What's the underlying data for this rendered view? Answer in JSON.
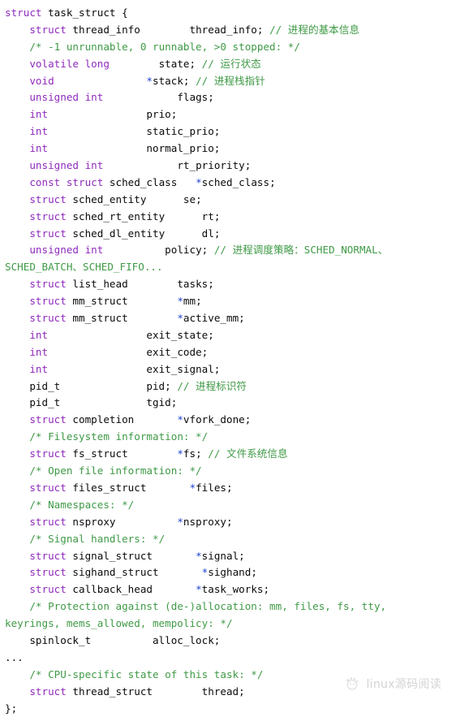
{
  "document": {
    "kind": "source-code-listing",
    "language": "c",
    "colors": {
      "background": "#ffffff",
      "keyword": "#8f2bbd",
      "comment": "#3f9a46",
      "identifier": "#0a0a0a",
      "pointer": "#1a3fd0",
      "watermark": "#b9b9b9"
    }
  },
  "watermark": {
    "logo_icon": "cat-paw-circle-icon",
    "text": "linux源码阅读"
  },
  "code": {
    "lines": [
      [
        {
          "t": "struct",
          "c": "kw"
        },
        {
          "t": " task_struct {",
          "c": "id"
        }
      ],
      [
        {
          "t": "    ",
          "c": "pun"
        },
        {
          "t": "struct",
          "c": "kw"
        },
        {
          "t": " thread_info        thread_info; ",
          "c": "id"
        },
        {
          "t": "// 进程的基本信息",
          "c": "cm"
        }
      ],
      [
        {
          "t": "    ",
          "c": "pun"
        },
        {
          "t": "/* -1 unrunnable, 0 runnable, >0 stopped: */",
          "c": "cm"
        }
      ],
      [
        {
          "t": "    ",
          "c": "pun"
        },
        {
          "t": "volatile long",
          "c": "kw"
        },
        {
          "t": "        state; ",
          "c": "id"
        },
        {
          "t": "// 运行状态",
          "c": "cm"
        }
      ],
      [
        {
          "t": "    ",
          "c": "pun"
        },
        {
          "t": "void",
          "c": "kw"
        },
        {
          "t": "               ",
          "c": "id"
        },
        {
          "t": "*",
          "c": "ptr"
        },
        {
          "t": "stack; ",
          "c": "id"
        },
        {
          "t": "// 进程栈指针",
          "c": "cm"
        }
      ],
      [
        {
          "t": "    ",
          "c": "pun"
        },
        {
          "t": "unsigned int",
          "c": "kw"
        },
        {
          "t": "            flags;",
          "c": "id"
        }
      ],
      [
        {
          "t": "    ",
          "c": "pun"
        },
        {
          "t": "int",
          "c": "kw"
        },
        {
          "t": "                prio;",
          "c": "id"
        }
      ],
      [
        {
          "t": "    ",
          "c": "pun"
        },
        {
          "t": "int",
          "c": "kw"
        },
        {
          "t": "                static_prio;",
          "c": "id"
        }
      ],
      [
        {
          "t": "    ",
          "c": "pun"
        },
        {
          "t": "int",
          "c": "kw"
        },
        {
          "t": "                normal_prio;",
          "c": "id"
        }
      ],
      [
        {
          "t": "    ",
          "c": "pun"
        },
        {
          "t": "unsigned int",
          "c": "kw"
        },
        {
          "t": "            rt_priority;",
          "c": "id"
        }
      ],
      [
        {
          "t": "    ",
          "c": "pun"
        },
        {
          "t": "const struct",
          "c": "kw"
        },
        {
          "t": " sched_class   ",
          "c": "id"
        },
        {
          "t": "*",
          "c": "ptr"
        },
        {
          "t": "sched_class;",
          "c": "id"
        }
      ],
      [
        {
          "t": "    ",
          "c": "pun"
        },
        {
          "t": "struct",
          "c": "kw"
        },
        {
          "t": " sched_entity      se;",
          "c": "id"
        }
      ],
      [
        {
          "t": "    ",
          "c": "pun"
        },
        {
          "t": "struct",
          "c": "kw"
        },
        {
          "t": " sched_rt_entity      rt;",
          "c": "id"
        }
      ],
      [
        {
          "t": "    ",
          "c": "pun"
        },
        {
          "t": "struct",
          "c": "kw"
        },
        {
          "t": " sched_dl_entity      dl;",
          "c": "id"
        }
      ],
      [
        {
          "t": "    ",
          "c": "pun"
        },
        {
          "t": "unsigned int",
          "c": "kw"
        },
        {
          "t": "          policy; ",
          "c": "id"
        },
        {
          "t": "// 进程调度策略：SCHED_NORMAL、",
          "c": "cm"
        }
      ],
      [
        {
          "t": "SCHED_BATCH、SCHED_FIFO...",
          "c": "cm"
        }
      ],
      [
        {
          "t": "    ",
          "c": "pun"
        },
        {
          "t": "struct",
          "c": "kw"
        },
        {
          "t": " list_head        tasks;",
          "c": "id"
        }
      ],
      [
        {
          "t": "    ",
          "c": "pun"
        },
        {
          "t": "struct",
          "c": "kw"
        },
        {
          "t": " mm_struct        ",
          "c": "id"
        },
        {
          "t": "*",
          "c": "ptr"
        },
        {
          "t": "mm;",
          "c": "id"
        }
      ],
      [
        {
          "t": "    ",
          "c": "pun"
        },
        {
          "t": "struct",
          "c": "kw"
        },
        {
          "t": " mm_struct        ",
          "c": "id"
        },
        {
          "t": "*",
          "c": "ptr"
        },
        {
          "t": "active_mm;",
          "c": "id"
        }
      ],
      [
        {
          "t": "    ",
          "c": "pun"
        },
        {
          "t": "int",
          "c": "kw"
        },
        {
          "t": "                exit_state;",
          "c": "id"
        }
      ],
      [
        {
          "t": "    ",
          "c": "pun"
        },
        {
          "t": "int",
          "c": "kw"
        },
        {
          "t": "                exit_code;",
          "c": "id"
        }
      ],
      [
        {
          "t": "    ",
          "c": "pun"
        },
        {
          "t": "int",
          "c": "kw"
        },
        {
          "t": "                exit_signal;",
          "c": "id"
        }
      ],
      [
        {
          "t": "    pid_t              pid; ",
          "c": "id"
        },
        {
          "t": "// 进程标识符",
          "c": "cm"
        }
      ],
      [
        {
          "t": "    pid_t              tgid;",
          "c": "id"
        }
      ],
      [
        {
          "t": "    ",
          "c": "pun"
        },
        {
          "t": "struct",
          "c": "kw"
        },
        {
          "t": " completion       ",
          "c": "id"
        },
        {
          "t": "*",
          "c": "ptr"
        },
        {
          "t": "vfork_done;",
          "c": "id"
        }
      ],
      [
        {
          "t": "    ",
          "c": "pun"
        },
        {
          "t": "/* Filesystem information: */",
          "c": "cm"
        }
      ],
      [
        {
          "t": "    ",
          "c": "pun"
        },
        {
          "t": "struct",
          "c": "kw"
        },
        {
          "t": " fs_struct        ",
          "c": "id"
        },
        {
          "t": "*",
          "c": "ptr"
        },
        {
          "t": "fs; ",
          "c": "id"
        },
        {
          "t": "// 文件系统信息",
          "c": "cm"
        }
      ],
      [
        {
          "t": "    ",
          "c": "pun"
        },
        {
          "t": "/* Open file information: */",
          "c": "cm"
        }
      ],
      [
        {
          "t": "    ",
          "c": "pun"
        },
        {
          "t": "struct",
          "c": "kw"
        },
        {
          "t": " files_struct       ",
          "c": "id"
        },
        {
          "t": "*",
          "c": "ptr"
        },
        {
          "t": "files;",
          "c": "id"
        }
      ],
      [
        {
          "t": "    ",
          "c": "pun"
        },
        {
          "t": "/* Namespaces: */",
          "c": "cm"
        }
      ],
      [
        {
          "t": "    ",
          "c": "pun"
        },
        {
          "t": "struct",
          "c": "kw"
        },
        {
          "t": " nsproxy          ",
          "c": "id"
        },
        {
          "t": "*",
          "c": "ptr"
        },
        {
          "t": "nsproxy;",
          "c": "id"
        }
      ],
      [
        {
          "t": "    ",
          "c": "pun"
        },
        {
          "t": "/* Signal handlers: */",
          "c": "cm"
        }
      ],
      [
        {
          "t": "    ",
          "c": "pun"
        },
        {
          "t": "struct",
          "c": "kw"
        },
        {
          "t": " signal_struct       ",
          "c": "id"
        },
        {
          "t": "*",
          "c": "ptr"
        },
        {
          "t": "signal;",
          "c": "id"
        }
      ],
      [
        {
          "t": "    ",
          "c": "pun"
        },
        {
          "t": "struct",
          "c": "kw"
        },
        {
          "t": " sighand_struct       ",
          "c": "id"
        },
        {
          "t": "*",
          "c": "ptr"
        },
        {
          "t": "sighand;",
          "c": "id"
        }
      ],
      [
        {
          "t": "    ",
          "c": "pun"
        },
        {
          "t": "struct",
          "c": "kw"
        },
        {
          "t": " callback_head       ",
          "c": "id"
        },
        {
          "t": "*",
          "c": "ptr"
        },
        {
          "t": "task_works;",
          "c": "id"
        }
      ],
      [
        {
          "t": "    ",
          "c": "pun"
        },
        {
          "t": "/* Protection against (de-)allocation: mm, files, fs, tty,",
          "c": "cm"
        }
      ],
      [
        {
          "t": "keyrings, mems_allowed, mempolicy: */",
          "c": "cm"
        }
      ],
      [
        {
          "t": "    spinlock_t          alloc_lock;",
          "c": "id"
        }
      ],
      [
        {
          "t": "...",
          "c": "id"
        }
      ],
      [
        {
          "t": "    ",
          "c": "pun"
        },
        {
          "t": "/* CPU-specific state of this task: */",
          "c": "cm"
        }
      ],
      [
        {
          "t": "    ",
          "c": "pun"
        },
        {
          "t": "struct",
          "c": "kw"
        },
        {
          "t": " thread_struct        thread;",
          "c": "id"
        }
      ],
      [
        {
          "t": "};",
          "c": "id"
        }
      ]
    ]
  }
}
